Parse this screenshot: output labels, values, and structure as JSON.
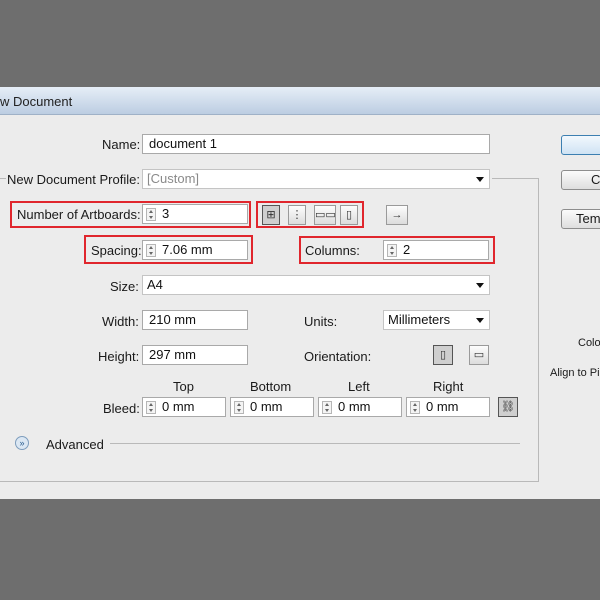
{
  "dialog": {
    "title": "w Document"
  },
  "form": {
    "name": {
      "label": "Name:",
      "value": "document 1"
    },
    "profile": {
      "label": "New Document Profile:",
      "value": "[Custom]"
    },
    "artboards": {
      "label": "Number of Artboards:",
      "value": "3"
    },
    "layout_icons": [
      "grid-by-row-icon",
      "grid-by-column-icon",
      "arrange-by-row-icon",
      "arrange-by-column-icon"
    ],
    "direction_icon": "right-to-left-arrow-icon",
    "spacing": {
      "label": "Spacing:",
      "value": "7.06 mm"
    },
    "columns": {
      "label": "Columns:",
      "value": "2"
    },
    "size": {
      "label": "Size:",
      "value": "A4"
    },
    "width": {
      "label": "Width:",
      "value": "210 mm"
    },
    "units": {
      "label": "Units:",
      "value": "Millimeters"
    },
    "height": {
      "label": "Height:",
      "value": "297 mm"
    },
    "orientation": {
      "label": "Orientation:",
      "icons": [
        "portrait-icon",
        "landscape-icon"
      ]
    },
    "bleed": {
      "label": "Bleed:",
      "columns": [
        "Top",
        "Bottom",
        "Left",
        "Right"
      ],
      "values": [
        "0 mm",
        "0 mm",
        "0 mm",
        "0 mm"
      ],
      "link_icon": "chain-link-icon"
    },
    "advanced": {
      "label": "Advanced",
      "icon": "expand-chevron-icon"
    }
  },
  "side": {
    "buttons": [
      "",
      "Co",
      "Tem"
    ],
    "color_label": "Colo",
    "align_label": "Align to Pi"
  },
  "highlight_color": "#e0262d"
}
